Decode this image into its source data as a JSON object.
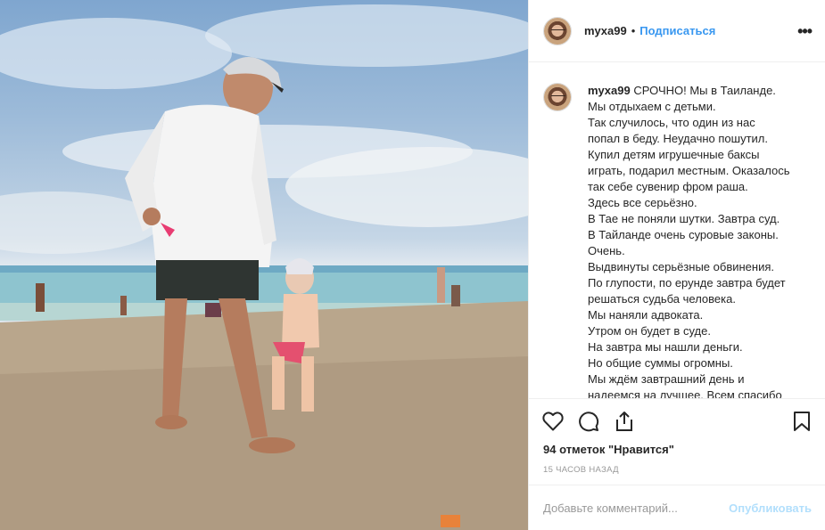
{
  "post": {
    "image_alt": "Мужчина с ребёнком на пляже",
    "colors": {
      "accent": "#3897f0",
      "publish_disabled": "#b2dffc",
      "muted": "#999999"
    }
  },
  "header": {
    "username": "myxa99",
    "dot": "•",
    "follow_label": "Подписаться",
    "more_icon": "more-options-icon",
    "more_glyph": "•••"
  },
  "caption": {
    "username": "myxa99",
    "lines": [
      "СРОЧНО! Мы в Таиланде.",
      "Мы отдыхаем с детьми.",
      "Так случилось, что один из нас",
      "попал в беду. Неудачно пошутил.",
      "Купил детям игрушечные баксы",
      "играть, подарил местным. Оказалось",
      "так себе сувенир фром раша.",
      "Здесь все серьёзно.",
      "В Тае не поняли шутки. Завтра суд.",
      "В Тайланде очень суровые законы.",
      "Очень.",
      "Выдвинуты серьёзные обвинения.",
      "По глупости, по ерунде завтра будет",
      "решаться судьба человека.",
      "Мы наняли адвоката.",
      "Утром он будет в суде.",
      "На завтра мы нашли деньги.",
      "Но общие суммы огромны.",
      "Мы ждём завтрашний день и",
      "надеемся на лучшее. Всем спасибо"
    ]
  },
  "actions": {
    "icons": [
      "heart-icon",
      "comment-icon",
      "share-icon",
      "bookmark-icon"
    ],
    "likes_text": "94 отметок \"Нравится\"",
    "time_text": "15 ЧАСОВ НАЗАД"
  },
  "comment": {
    "placeholder": "Добавьте комментарий...",
    "publish_label": "Опубликовать"
  }
}
